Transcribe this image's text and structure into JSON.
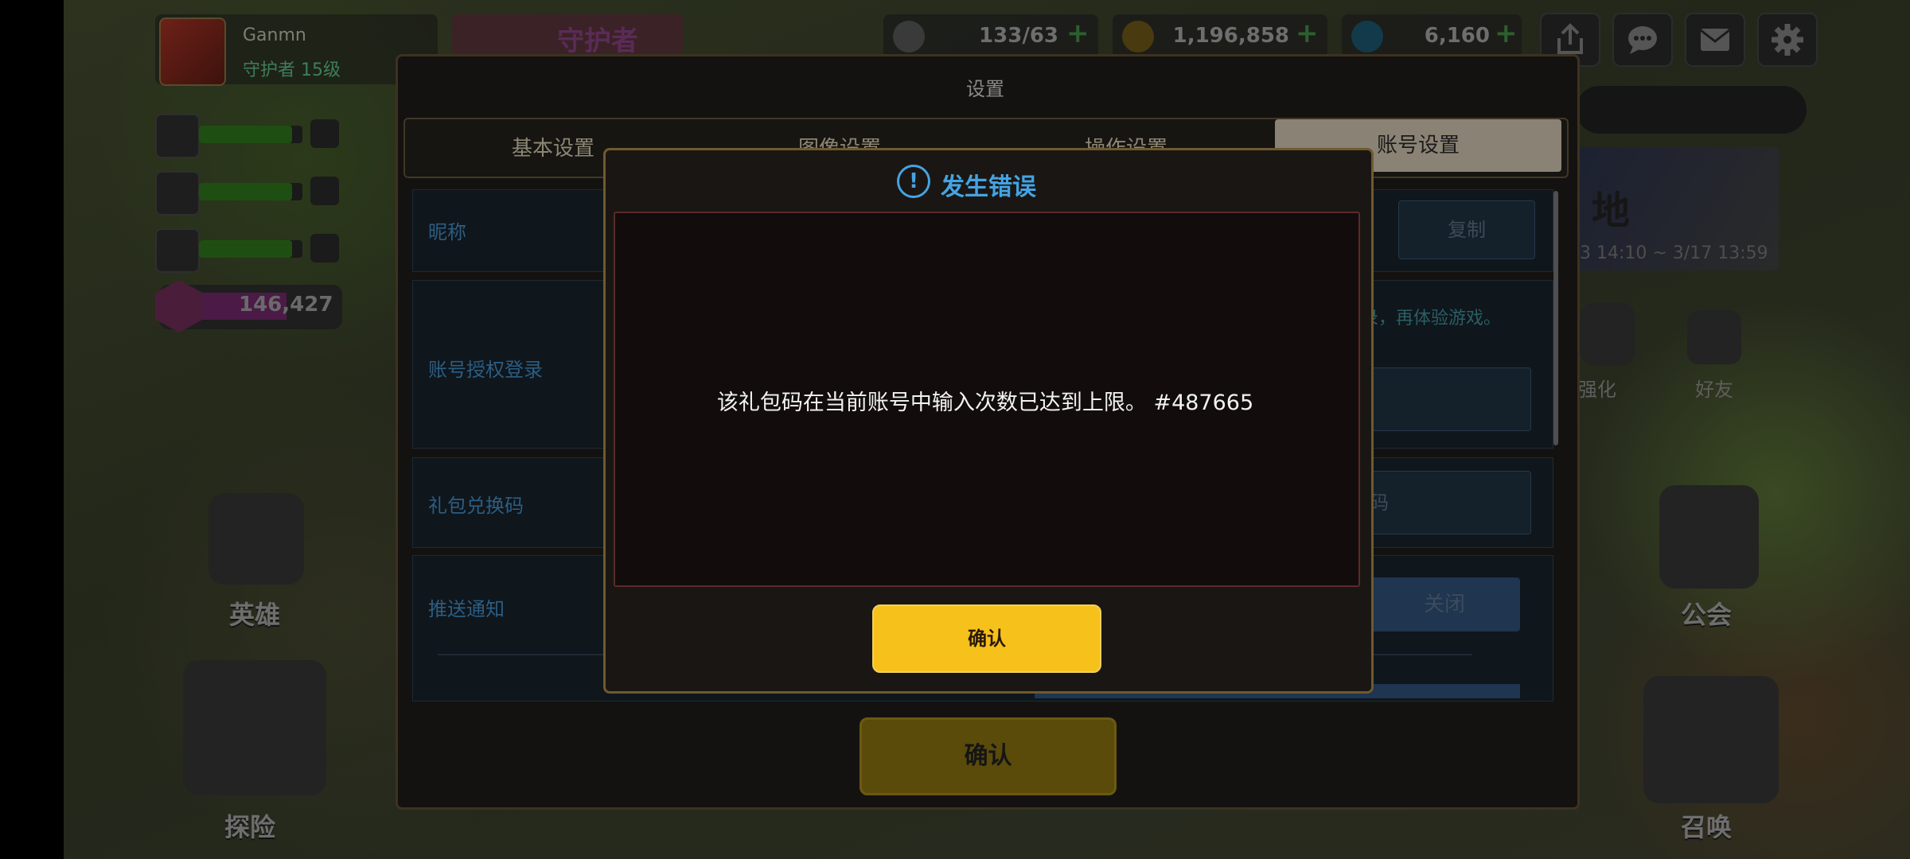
{
  "player": {
    "name": "Ganmn",
    "rank": "守护者 15级"
  },
  "banner": {
    "title": "守护者"
  },
  "resources": [
    {
      "name": "coffee",
      "icon": "coffee-cup-icon",
      "value": "133/63"
    },
    {
      "name": "gold",
      "icon": "gold-coin-icon",
      "value": "1,196,858"
    },
    {
      "name": "gems",
      "icon": "diamond-icon",
      "value": "6,160"
    }
  ],
  "plus_symbol": "+",
  "top_buttons": [
    "share-icon",
    "chat-icon",
    "mail-icon",
    "gear-icon"
  ],
  "stats": {
    "heart_value": "146,427",
    "bars_fill": [
      0.9,
      0.9,
      0.9
    ]
  },
  "left_nav": {
    "hero": "英雄",
    "adventure": "探险"
  },
  "right_nav": {
    "enhance": "强化",
    "friends": "好友",
    "guild": "公会",
    "summon": "召唤"
  },
  "event": {
    "title": "地",
    "time": "3 14:10 ~ 3/17 13:59"
  },
  "settings": {
    "title": "设置",
    "tabs": [
      "基本设置",
      "图像设置",
      "操作设置",
      "账号设置"
    ],
    "rows": {
      "nickname": "昵称",
      "copy_button": "复制",
      "auth_login": "账号授权登录",
      "auth_hint": "录，再体验游戏。",
      "gift_code": "礼包兑换码",
      "gift_code_field": "码",
      "push": "推送通知",
      "push_toggle": "关闭"
    },
    "confirm": "确认"
  },
  "error_modal": {
    "title": "发生错误",
    "icon": "!",
    "message": "该礼包码在当前账号中输入次数已达到上限。  #487665",
    "confirm": "确认"
  },
  "colors": {
    "accent_blue": "#44a3e3",
    "confirm_yellow": "#f7c11b",
    "title_text": "#f2f2f2"
  }
}
